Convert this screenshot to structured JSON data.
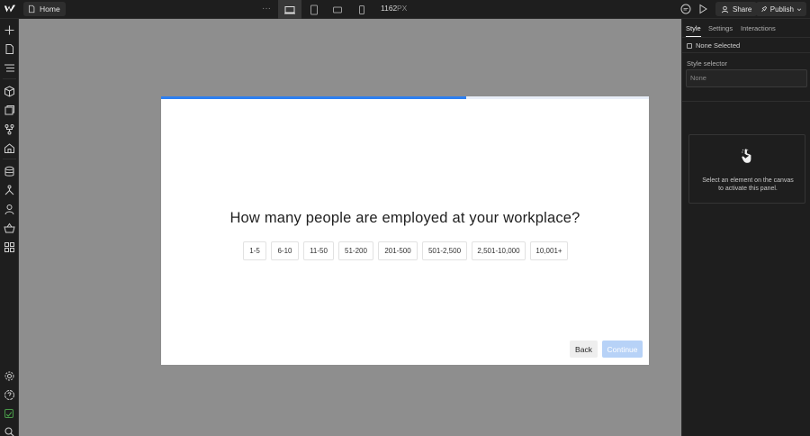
{
  "topbar": {
    "logo": "webflow-logo-icon",
    "home_label": "Home",
    "breakpoints": [
      "desktop-icon",
      "tablet-icon",
      "mobile-landscape-icon",
      "mobile-portrait-icon"
    ],
    "canvas_width_value": "1162",
    "canvas_width_unit": "PX",
    "share_label": "Share",
    "publish_label": "Publish"
  },
  "left_toolbar": {
    "icons": [
      "add-icon",
      "pages-icon",
      "navigator-icon",
      "components-icon",
      "assets-icon",
      "variables-icon",
      "apps-icon",
      "cms-icon",
      "logic-icon",
      "users-icon",
      "ecommerce-icon",
      "marketplace-icon",
      "settings-icon",
      "help-icon",
      "audit-icon",
      "search-icon"
    ]
  },
  "modal": {
    "progress": 0.625,
    "question": "How many people are employed at your workplace?",
    "options": [
      "1-5",
      "6-10",
      "11-50",
      "51-200",
      "201-500",
      "501-2,500",
      "2,501-10,000",
      "10,001+"
    ],
    "back_label": "Back",
    "continue_label": "Continue"
  },
  "right_panel": {
    "tabs": [
      "Style",
      "Settings",
      "Interactions"
    ],
    "active_tab": "Style",
    "selection_label": "None Selected",
    "style_selector_label": "Style selector",
    "style_selector_placeholder": "None",
    "empty_state_line1": "Select an element on the canvas",
    "empty_state_line2": "to activate this panel."
  },
  "colors": {
    "accent": "#2d7ff0",
    "continue_disabled": "#b7d2f7",
    "canvas_bg": "#8e8e8e",
    "ui_bg": "#1e1e1e"
  }
}
